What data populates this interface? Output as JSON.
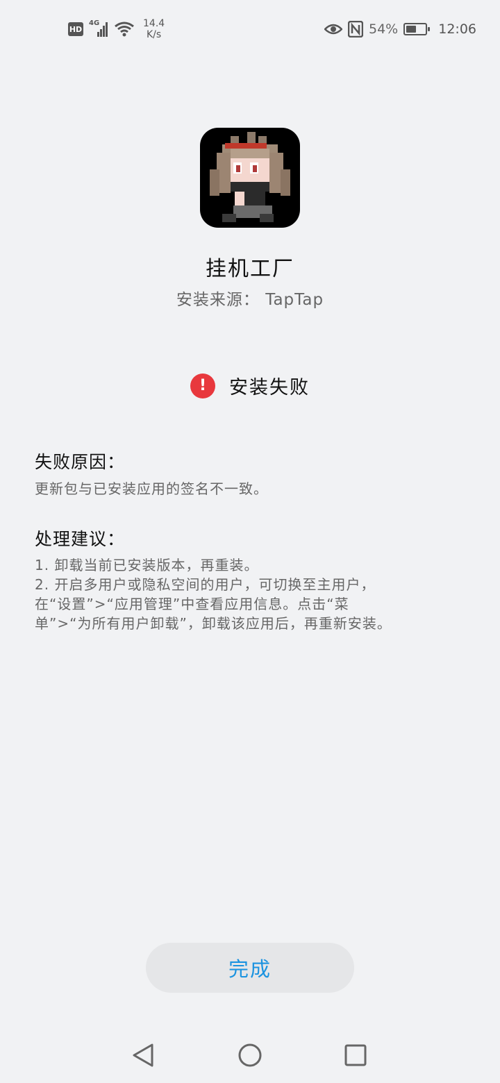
{
  "status_bar": {
    "hd_label": "HD",
    "network_label": "4G",
    "speed_value": "14.4",
    "speed_unit": "K/s",
    "battery_text": "54%",
    "battery_level": 0.54,
    "time": "12:06"
  },
  "app": {
    "name": "挂机工厂",
    "source": "安装来源： TapTap"
  },
  "status": {
    "icon": "exclamation-icon",
    "text": "安装失败",
    "color": "#e8383d"
  },
  "failure_reason": {
    "title": "失败原因：",
    "body": "更新包与已安装应用的签名不一致。"
  },
  "suggestions": {
    "title": "处理建议：",
    "lines": [
      "1. 卸载当前已安装版本，再重装。",
      "2. 开启多用户或隐私空间的用户，可切换至主用户，",
      "在“设置”>“应用管理”中查看应用信息。点击“菜",
      "单”>“为所有用户卸载”，卸载该应用后，再重新安装。"
    ]
  },
  "done_button": {
    "label": "完成",
    "color": "#1b93e0"
  },
  "nav": {
    "back": "back-triangle-icon",
    "home": "home-circle-icon",
    "recents": "recents-square-icon"
  }
}
